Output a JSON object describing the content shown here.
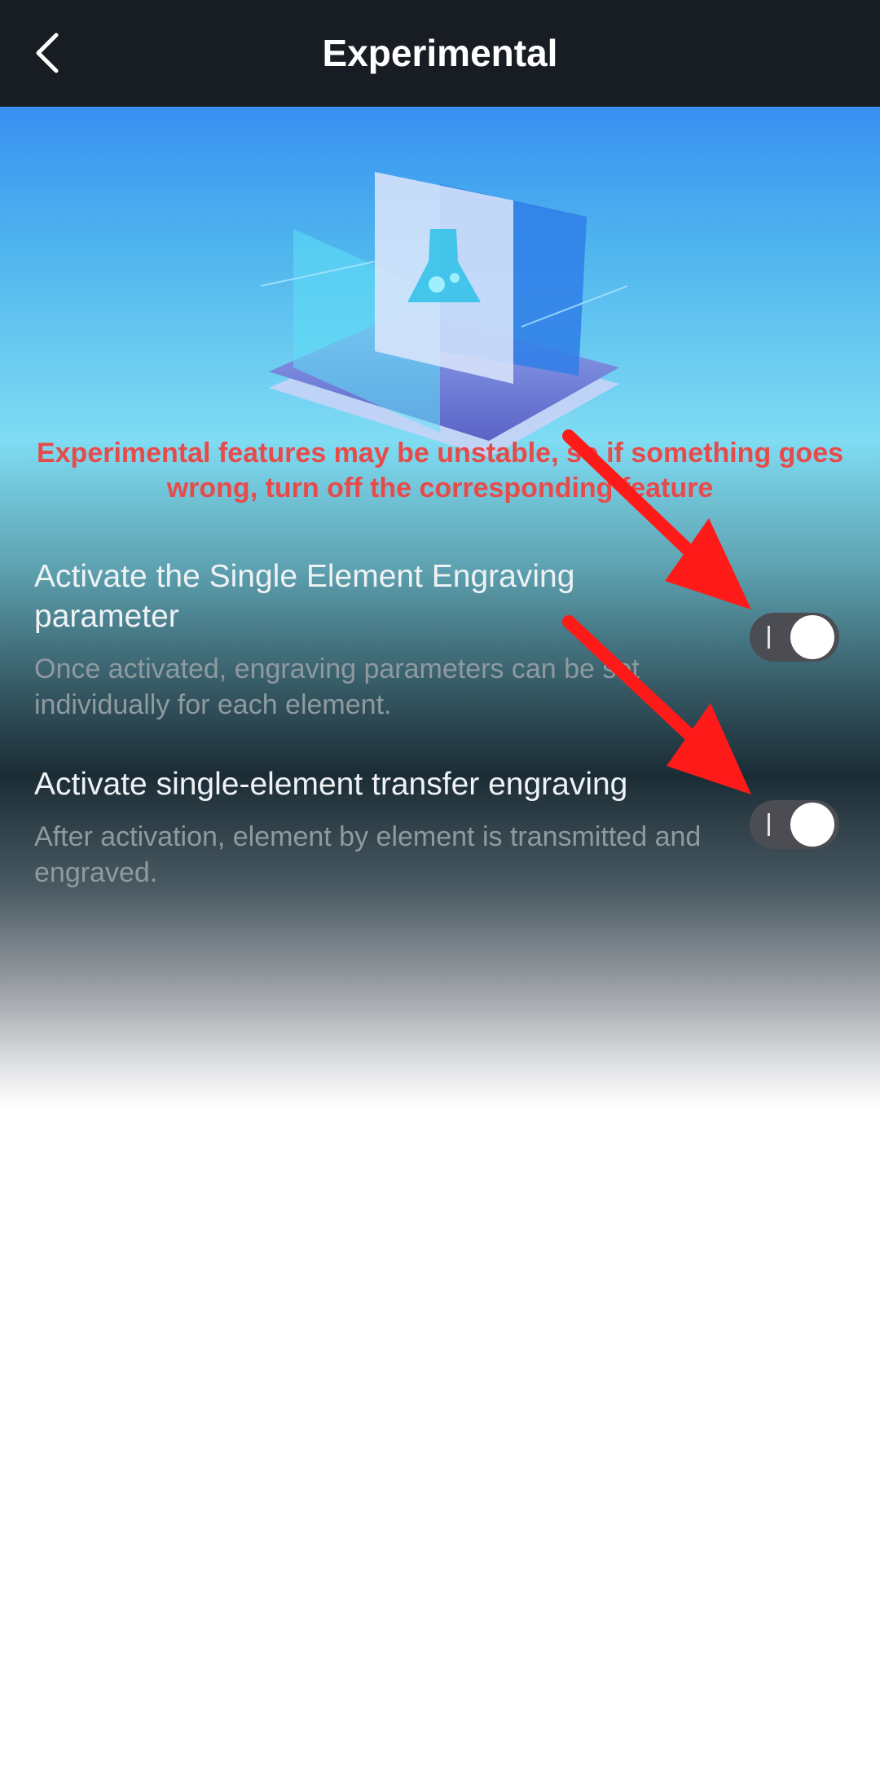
{
  "header": {
    "back_icon": "chevron-left-icon",
    "title": "Experimental"
  },
  "hero": {
    "illustration": "flask-lab-icon"
  },
  "warning": {
    "text": "Experimental features may be unstable, so if something goes wrong, turn off the corresponding feature",
    "color": "#e84a4a"
  },
  "settings": [
    {
      "title": "Activate the Single Element Engraving parameter",
      "description": "Once activated, engraving parameters can be set individually for each element.",
      "enabled": true
    },
    {
      "title": "Activate single-element transfer engraving",
      "description": "After activation, element by element is transmitted and engraved.",
      "enabled": true
    }
  ],
  "annotations": {
    "arrow_color": "#ff1a1a"
  }
}
